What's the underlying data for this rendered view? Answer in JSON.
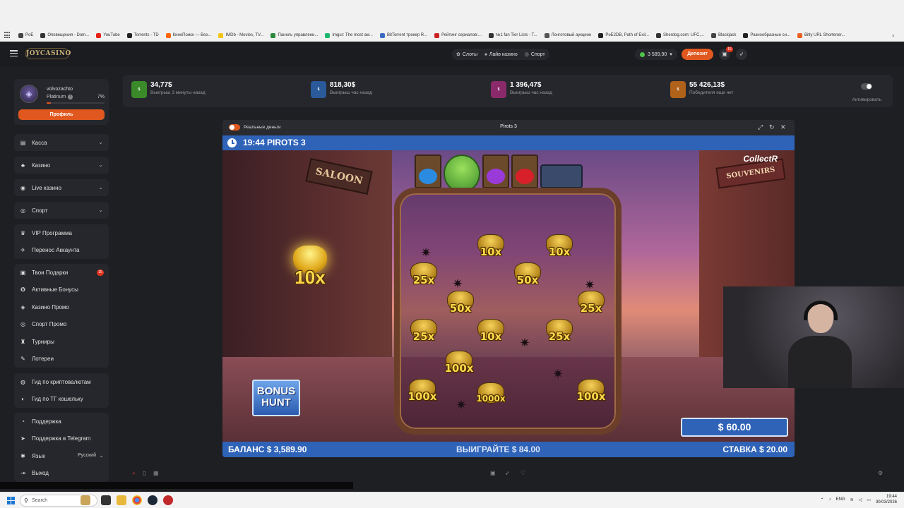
{
  "bookmarks": [
    {
      "label": "PoE",
      "color": "#444444"
    },
    {
      "label": "Оповещения - Dom...",
      "color": "#333333"
    },
    {
      "label": "YouTube",
      "color": "#e62117"
    },
    {
      "label": "Torrents - TD",
      "color": "#222222"
    },
    {
      "label": "КиноПоиск — Все...",
      "color": "#f60"
    },
    {
      "label": "IMDb - Movies, TV...",
      "color": "#f5c518"
    },
    {
      "label": "Панель управлени...",
      "color": "#2a8a3a"
    },
    {
      "label": "Imgur: The most aw...",
      "color": "#1bb76e"
    },
    {
      "label": "BitTorrent трекер R...",
      "color": "#3b6cc2"
    },
    {
      "label": "Рейтинг сериалов:...",
      "color": "#cc2222"
    },
    {
      "label": "№1 fan Tier Lists - T...",
      "color": "#333333"
    },
    {
      "label": "Лонготовый аукцион",
      "color": "#555555"
    },
    {
      "label": "PoE2DB, Path of Exil...",
      "color": "#222222"
    },
    {
      "label": "Sherdog.com: UFC,...",
      "color": "#333333"
    },
    {
      "label": "Blackjack",
      "color": "#444444"
    },
    {
      "label": "Разнообразные си...",
      "color": "#222222"
    },
    {
      "label": "Bitly URL Shortener...",
      "color": "#ee6123"
    }
  ],
  "header": {
    "logo": "JOYCASINO",
    "nav": [
      {
        "label": "Слоты",
        "icon": "cherry-icon"
      },
      {
        "label": "Лайв казино",
        "icon": "cards-icon"
      },
      {
        "label": "Спорт",
        "icon": "ball-icon"
      }
    ],
    "balance": "3 589,90",
    "deposit_label": "Депозит",
    "gift_count": "15",
    "accent": "#e0581f"
  },
  "profile": {
    "username": "volvozachto",
    "rank": "Platinum",
    "progress_pct": "7%",
    "progress": 0.07,
    "button": "Профиль"
  },
  "sidebar": {
    "collapsible": [
      {
        "label": "Касса",
        "icon": "wallet-icon"
      },
      {
        "label": "Казино",
        "icon": "casino-icon"
      },
      {
        "label": "Live казино",
        "icon": "live-icon"
      },
      {
        "label": "Спорт",
        "icon": "ball-icon"
      }
    ],
    "group1": [
      {
        "label": "VIP Программа",
        "icon": "vip-icon"
      },
      {
        "label": "Перенос Аккаунта",
        "icon": "transfer-icon"
      }
    ],
    "group2": [
      {
        "label": "Твои Подарки",
        "icon": "gift-icon",
        "badge": "15"
      },
      {
        "label": "Активные Бонусы",
        "icon": "bonus-icon"
      },
      {
        "label": "Казино Промо",
        "icon": "promo-icon"
      },
      {
        "label": "Спорт Промо",
        "icon": "sport-promo-icon"
      },
      {
        "label": "Турниры",
        "icon": "trophy-icon"
      },
      {
        "label": "Лотереи",
        "icon": "ticket-icon"
      }
    ],
    "group3": [
      {
        "label": "Гид по криптовалютам",
        "icon": "crypto-icon"
      },
      {
        "label": "Гид по ТГ кошельку",
        "icon": "telegram-wallet-icon"
      }
    ],
    "group4": [
      {
        "label": "Поддержка",
        "icon": "support-icon"
      },
      {
        "label": "Поддержка в Telegram",
        "icon": "telegram-icon"
      },
      {
        "label": "Язык",
        "icon": "language-icon",
        "value": "Русский"
      },
      {
        "label": "Выход",
        "icon": "logout-icon"
      }
    ]
  },
  "jackpots": [
    {
      "amount": "34,77$",
      "sub": "Выигрыш 3 минуты назад",
      "color": "#3a8a2a"
    },
    {
      "amount": "818,30$",
      "sub": "Выигрыш час назад",
      "color": "#2a5a9a"
    },
    {
      "amount": "1 396,47$",
      "sub": "Выигрыш час назад",
      "color": "#8a2a6a"
    },
    {
      "amount": "55 426,13$",
      "sub": "Победителя еще нет",
      "color": "#b0611a"
    }
  ],
  "activate_label": "Активировать",
  "game": {
    "mode_label": "Реальные деньги",
    "title": "Pirots 3",
    "slot_header": "19:44 PIROTS 3",
    "collectr": "CollectR",
    "left_sign": "SALOON",
    "right_sign": "SOUVENIRS",
    "feature_multiplier": "10x",
    "bonus_hunt": "BONUS HUNT",
    "win_amount": "$ 60.00",
    "balance": "БАЛАНС $ 3,589.90",
    "win": "ВЫИГРАЙТЕ $ 84.00",
    "bet": "СТАВКА $ 20.00",
    "bags": [
      "10x",
      "10x",
      "25x",
      "50x",
      "50x",
      "25x",
      "25x",
      "10x",
      "25x",
      "100x",
      "100x",
      "1000x",
      "100x"
    ]
  },
  "taskbar": {
    "search": "Search",
    "lang": "ENG",
    "time": "19:44",
    "date": "30/03/2026"
  }
}
